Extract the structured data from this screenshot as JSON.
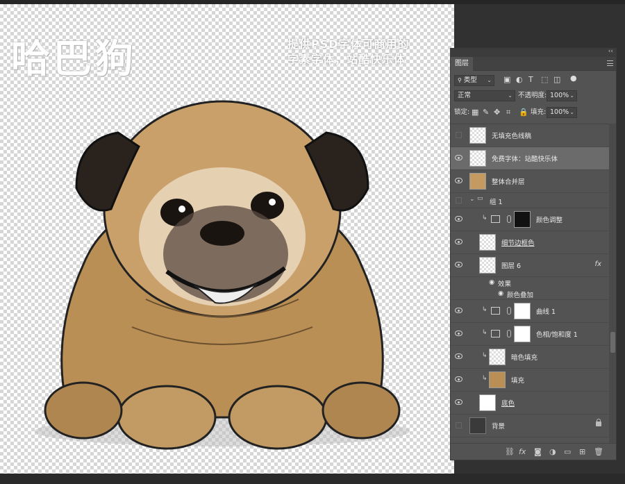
{
  "canvas": {
    "title": "哈巴狗",
    "promo_line1": "提供PSD字体可商用的",
    "promo_line2": "字素字体，站酷快乐体"
  },
  "panel": {
    "tab": "图层",
    "filter_kind": "类型",
    "blend_mode": "正常",
    "opacity_label": "不透明度:",
    "opacity_value": "100%",
    "lock_label": "锁定:",
    "fill_label": "填充:",
    "fill_value": "100%"
  },
  "layers": [
    {
      "name": "无填充色线稿",
      "visible": false
    },
    {
      "name": "免费字体：站酷快乐体",
      "visible": true,
      "selected": true
    },
    {
      "name": "整体合并层",
      "visible": true
    },
    {
      "name": "组 1",
      "visible": false
    },
    {
      "name": "颜色调整",
      "visible": true
    },
    {
      "name": "细节边框色",
      "visible": true
    },
    {
      "name": "图层 6",
      "visible": true
    },
    {
      "name": "效果"
    },
    {
      "name": "颜色叠加"
    },
    {
      "name": "曲线 1",
      "visible": true
    },
    {
      "name": "色相/饱和度 1",
      "visible": true
    },
    {
      "name": "暗色填充",
      "visible": true
    },
    {
      "name": "填充",
      "visible": true
    },
    {
      "name": "底色",
      "visible": true
    },
    {
      "name": "背景",
      "visible": false
    }
  ],
  "footer_icons": [
    "link-icon",
    "fx-icon",
    "mask-icon",
    "adjustment-icon",
    "folder-icon",
    "new-layer-icon",
    "trash-icon"
  ],
  "colors": {
    "panel_bg": "#535353",
    "selected_row": "#6b6b6b",
    "dog_fur": "#b98f55"
  }
}
